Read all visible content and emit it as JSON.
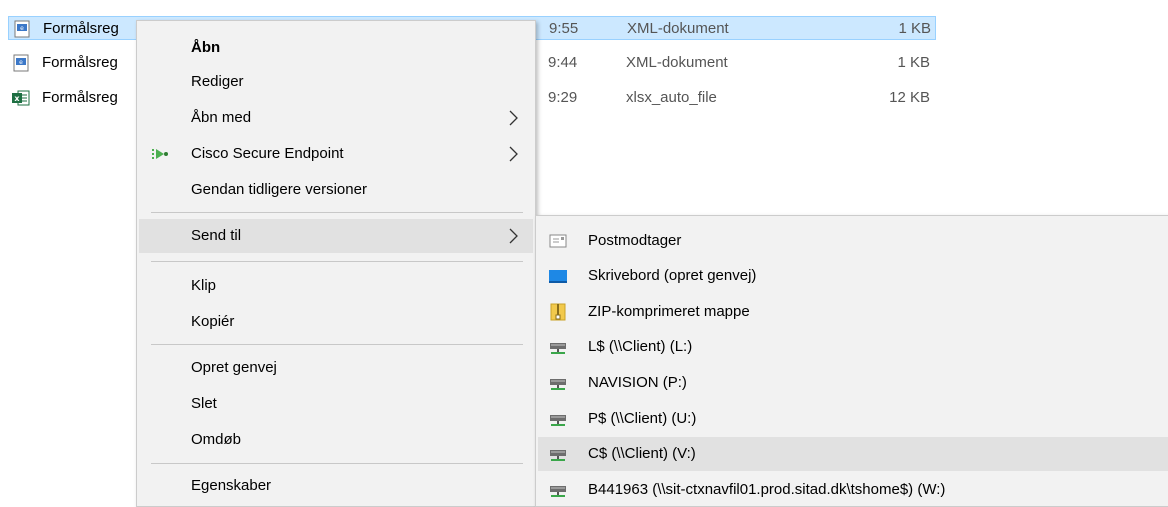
{
  "files": [
    {
      "name": "Formålsreg",
      "time": "9:55",
      "type": "XML-dokument",
      "size": "1 KB",
      "icon": "xml-file-icon",
      "selected": true
    },
    {
      "name": "Formålsreg",
      "time": "9:44",
      "type": "XML-dokument",
      "size": "1 KB",
      "icon": "xml-file-icon",
      "selected": false
    },
    {
      "name": "Formålsreg",
      "time": "9:29",
      "type": "xlsx_auto_file",
      "size": "12 KB",
      "icon": "excel-file-icon",
      "selected": false
    }
  ],
  "context_menu": {
    "open": "Åbn",
    "edit": "Rediger",
    "open_with": "Åbn med",
    "cisco": "Cisco Secure Endpoint",
    "restore": "Gendan tidligere versioner",
    "send_to": "Send til",
    "cut": "Klip",
    "copy": "Kopiér",
    "create_shortcut": "Opret genvej",
    "delete": "Slet",
    "rename": "Omdøb",
    "properties": "Egenskaber"
  },
  "send_to_menu": {
    "items": [
      {
        "label": "Postmodtager",
        "icon": "mail-recipient-icon"
      },
      {
        "label": "Skrivebord (opret genvej)",
        "icon": "desktop-icon"
      },
      {
        "label": "ZIP-komprimeret mappe",
        "icon": "zip-folder-icon"
      },
      {
        "label": "L$ (\\\\Client) (L:)",
        "icon": "network-drive-icon"
      },
      {
        "label": "NAVISION (P:)",
        "icon": "network-drive-icon"
      },
      {
        "label": "P$ (\\\\Client) (U:)",
        "icon": "network-drive-icon"
      },
      {
        "label": "C$ (\\\\Client) (V:)",
        "icon": "network-drive-icon"
      },
      {
        "label": "B441963 (\\\\sit-ctxnavfil01.prod.sitad.dk\\tshome$) (W:)",
        "icon": "network-drive-icon"
      }
    ]
  },
  "colors": {
    "selection": "#cce8ff",
    "menu_bg": "#f2f2f2",
    "menu_highlight": "#e1e1e1",
    "excel_green": "#1d6f42",
    "cisco_green": "#4caf50"
  }
}
